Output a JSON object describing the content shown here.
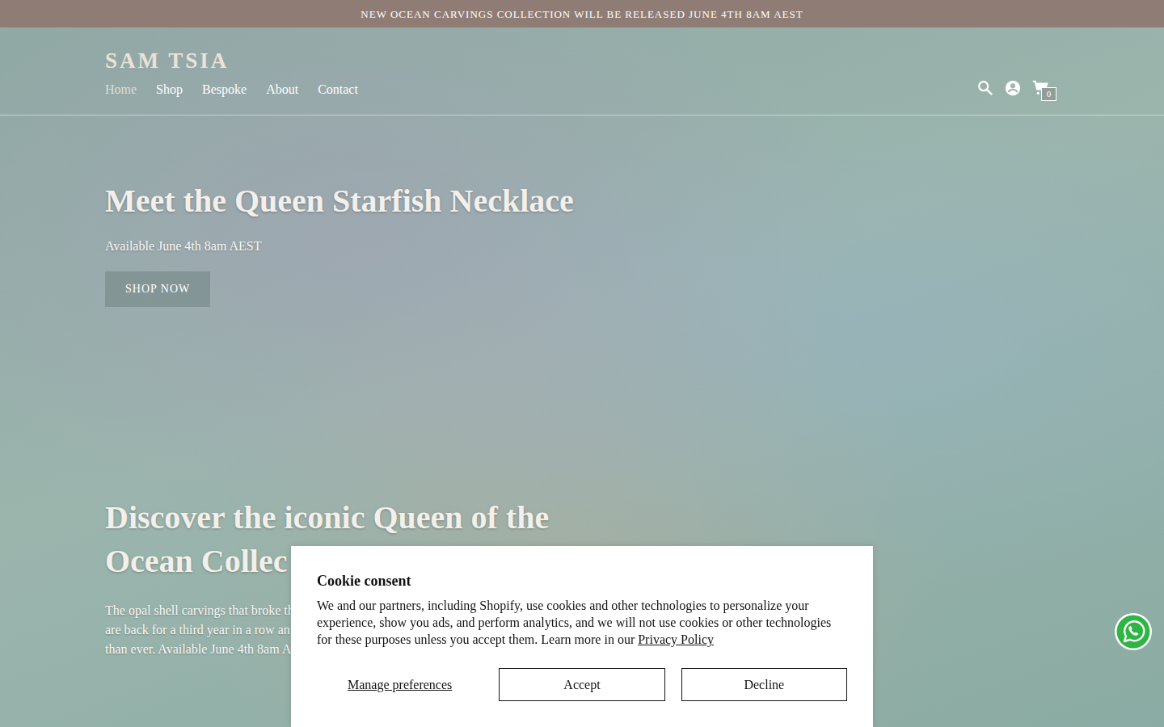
{
  "announcement": "NEW OCEAN CARVINGS COLLECTION WILL BE RELEASED JUNE 4TH 8AM AEST",
  "logo": "SAM TSIA",
  "nav": [
    {
      "label": "Home",
      "selected": true
    },
    {
      "label": "Shop",
      "selected": false
    },
    {
      "label": "Bespoke",
      "selected": false
    },
    {
      "label": "About",
      "selected": false
    },
    {
      "label": "Contact",
      "selected": false
    }
  ],
  "cart": {
    "count": "0"
  },
  "hero": {
    "title": "Meet the Queen Starfish Necklace",
    "subtitle": "Available June 4th 8am AEST",
    "button": "SHOP NOW"
  },
  "feature": {
    "title": "Discover the iconic Queen of the Ocean Collec",
    "lines": [
      "The opal shell carvings that broke th",
      "are back for a third year in a row an",
      "than ever. Available June 4th 8am A"
    ]
  },
  "cookie": {
    "title": "Cookie consent",
    "text": "We and our partners, including Shopify, use cookies and other technologies to personalize your experience, show you ads, and perform analytics, and we will not use cookies or other technologies for these purposes unless you accept them. Learn more in our",
    "link": "Privacy Policy",
    "buttons": [
      {
        "label": "Manage preferences",
        "kind": "link"
      },
      {
        "label": "Accept",
        "kind": "outline"
      },
      {
        "label": "Decline",
        "kind": "outline"
      }
    ]
  }
}
